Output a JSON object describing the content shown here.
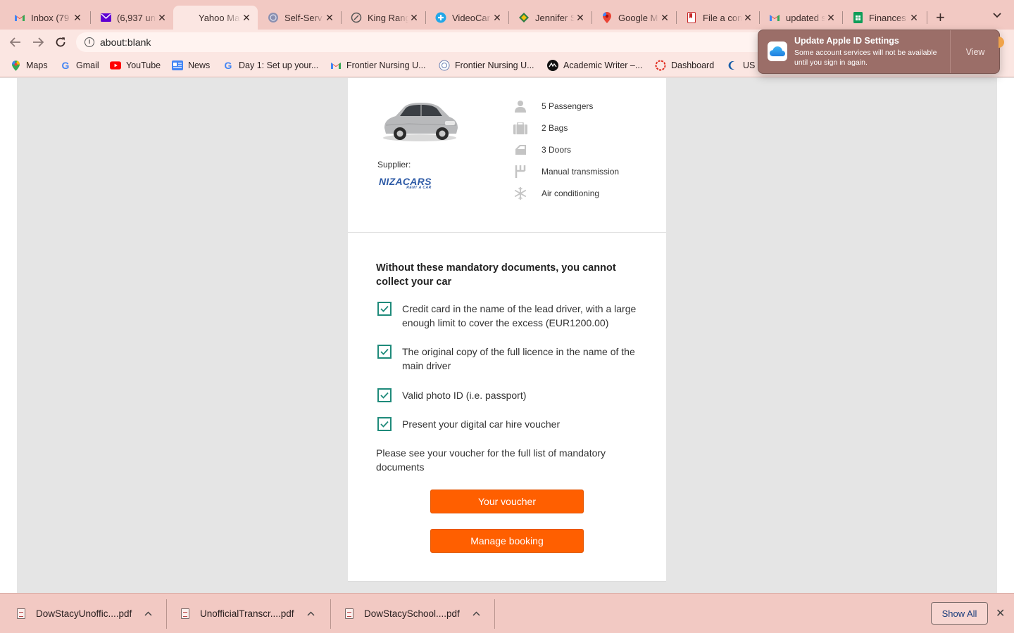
{
  "browser": {
    "tabs": [
      {
        "label": "Inbox (79",
        "icon": "gmail-icon",
        "active": false
      },
      {
        "label": "(6,937 un",
        "icon": "yahoo-mail-icon",
        "active": false
      },
      {
        "label": "Yahoo Ma",
        "icon": "",
        "active": true
      },
      {
        "label": "Self-Serv",
        "icon": "globe-icon",
        "active": false
      },
      {
        "label": "King Rang",
        "icon": "ring-icon",
        "active": false
      },
      {
        "label": "VideoCar",
        "icon": "plus-circle-icon",
        "active": false
      },
      {
        "label": "Jennifer S",
        "icon": "diamond-icon",
        "active": false
      },
      {
        "label": "Google M",
        "icon": "maps-pin-icon",
        "active": false
      },
      {
        "label": "File a con",
        "icon": "bookmark-icon",
        "active": false
      },
      {
        "label": "updated s",
        "icon": "gmail-icon",
        "active": false
      },
      {
        "label": "Finances",
        "icon": "sheets-icon",
        "active": false
      }
    ],
    "new_tab": "+",
    "tab_list": "⌄",
    "address": "about:blank",
    "bookmarks": [
      {
        "label": "Maps",
        "icon": "maps-pin-icon"
      },
      {
        "label": "Gmail",
        "icon": "google-icon"
      },
      {
        "label": "YouTube",
        "icon": "youtube-icon"
      },
      {
        "label": "News",
        "icon": "news-icon"
      },
      {
        "label": "Day 1: Set up your...",
        "icon": "google-icon"
      },
      {
        "label": "Frontier Nursing U...",
        "icon": "gmail-icon"
      },
      {
        "label": "Frontier Nursing U...",
        "icon": "seal-icon"
      },
      {
        "label": "Academic Writer –...",
        "icon": "aw-icon"
      },
      {
        "label": "Dashboard",
        "icon": "dashboard-icon"
      },
      {
        "label": "US",
        "icon": "crescent-icon"
      }
    ]
  },
  "notification": {
    "title": "Update Apple ID Settings",
    "body": "Some account services will not be available until you sign in again.",
    "action": "View",
    "icon": "icloud-icon"
  },
  "car": {
    "supplier_label": "Supplier:",
    "supplier_name": "NIZACARS",
    "supplier_tagline": "RENT A CAR",
    "specs": [
      {
        "label": "5 Passengers",
        "icon": "person-icon"
      },
      {
        "label": "2 Bags",
        "icon": "bag-icon"
      },
      {
        "label": "3 Doors",
        "icon": "door-icon"
      },
      {
        "label": "Manual transmission",
        "icon": "gearshift-icon"
      },
      {
        "label": "Air conditioning",
        "icon": "snowflake-icon"
      }
    ]
  },
  "documents": {
    "title": "Without these mandatory documents, you cannot collect your car",
    "items": [
      "Credit card in the name of the lead driver, with a large enough limit to cover the excess (EUR1200.00)",
      "The original copy of the full licence in the name of the main driver",
      "Valid photo ID (i.e. passport)",
      "Present your digital car hire voucher"
    ],
    "note": "Please see your voucher for the full list of mandatory documents",
    "voucher_button": "Your voucher",
    "manage_button": "Manage booking"
  },
  "downloads": {
    "files": [
      "DowStacyUnoffic....pdf",
      "UnofficialTranscr....pdf",
      "DowStacySchool....pdf"
    ],
    "show_all": "Show All"
  },
  "colors": {
    "accent": "#ff5f00",
    "check": "#1e8a7a",
    "chrome": "#f2c9c3"
  }
}
